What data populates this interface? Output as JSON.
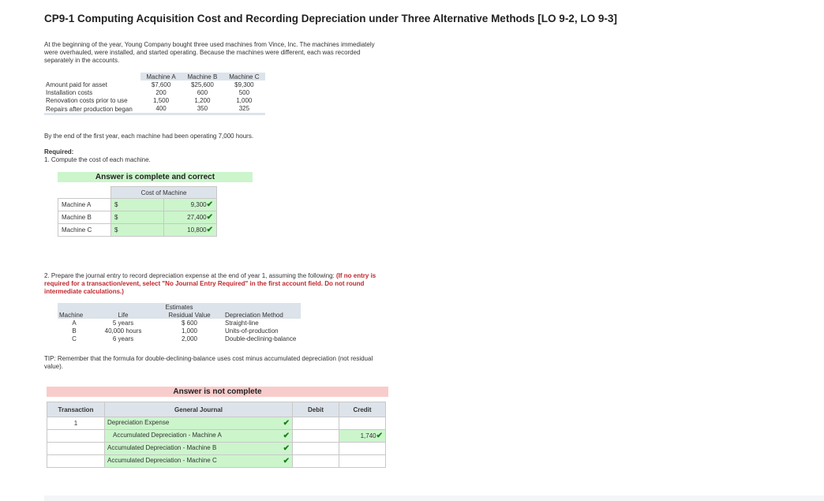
{
  "title": "CP9-1 Computing Acquisition Cost and Recording Depreciation under Three Alternative Methods [LO 9-2, LO 9-3]",
  "intro": "At the beginning of the year, Young Company bought three used machines from Vince, Inc. The machines immediately were overhauled, were installed, and started operating. Because the machines were different, each was recorded separately in the accounts.",
  "costs_table": {
    "headers": [
      "",
      "Machine A",
      "Machine B",
      "Machine C"
    ],
    "rows": [
      {
        "label": "Amount paid for asset",
        "a": "$7,600",
        "b": "$25,600",
        "c": "$9,300"
      },
      {
        "label": "Installation costs",
        "a": "200",
        "b": "600",
        "c": "500"
      },
      {
        "label": "Renovation costs prior to use",
        "a": "1,500",
        "b": "1,200",
        "c": "1,000"
      },
      {
        "label": "Repairs after production began",
        "a": "400",
        "b": "350",
        "c": "325"
      }
    ]
  },
  "after_year": "By the end of the first year, each machine had been operating 7,000 hours.",
  "required_label": "Required:",
  "req1": "1. Compute the cost of each machine.",
  "banner1": "Answer is complete and correct",
  "cost_of_machine": {
    "header": "Cost of Machine",
    "rows": [
      {
        "label": "Machine A",
        "cur": "$",
        "value": "9,300"
      },
      {
        "label": "Machine B",
        "cur": "$",
        "value": "27,400"
      },
      {
        "label": "Machine C",
        "cur": "$",
        "value": "10,800"
      }
    ]
  },
  "req2_main": "2. Prepare the journal entry to record depreciation expense at the end of year 1, assuming the following:",
  "req2_note": "(If no entry is required for a transaction/event, select \"No Journal Entry Required\" in the first account field. Do not round intermediate calculations.)",
  "estimates": {
    "group": "Estimates",
    "headers": [
      "Machine",
      "Life",
      "Residual Value",
      "Depreciation Method"
    ],
    "rows": [
      {
        "m": "A",
        "life": "5 years",
        "rv": "$ 600",
        "method": "Straight-line"
      },
      {
        "m": "B",
        "life": "40,000 hours",
        "rv": "1,000",
        "method": "Units-of-production"
      },
      {
        "m": "C",
        "life": "6 years",
        "rv": "2,000",
        "method": "Double-declining-balance"
      }
    ]
  },
  "tip": "TIP: Remember that the formula for double-declining-balance uses cost minus accumulated depreciation (not residual value).",
  "banner2": "Answer is not complete",
  "journal": {
    "headers": [
      "Transaction",
      "General Journal",
      "Debit",
      "Credit"
    ],
    "rows": [
      {
        "txn": "1",
        "account": "Depreciation Expense",
        "debit": "",
        "credit": "",
        "check": true
      },
      {
        "txn": "",
        "account": "Accumulated Depreciation - Machine A",
        "debit": "",
        "credit": "1,740",
        "check": true
      },
      {
        "txn": "",
        "account": "Accumulated Depreciation - Machine B",
        "debit": "",
        "credit": "",
        "check": true
      },
      {
        "txn": "",
        "account": "Accumulated Depreciation - Machine C",
        "debit": "",
        "credit": "",
        "check": true
      }
    ]
  },
  "check_icon": "checkmark-icon",
  "colors": {
    "correct_bg": "#ccf5cc",
    "incorrect_bg": "#f9cccc",
    "header_bg": "#dde3ea",
    "check": "#1a7f1a",
    "note_red": "#c0272d"
  }
}
